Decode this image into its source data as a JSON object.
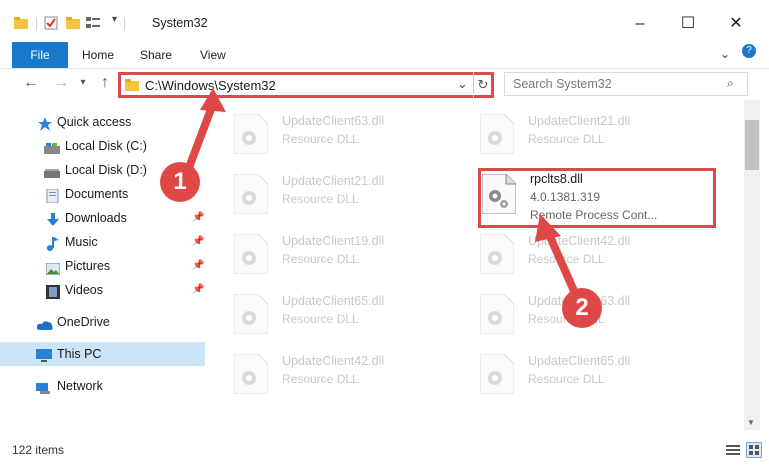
{
  "window": {
    "title": "System32",
    "controls": [
      "–",
      "☐",
      "✕"
    ]
  },
  "ribbon": {
    "file": "File",
    "tabs": [
      "Home",
      "Share",
      "View"
    ]
  },
  "address": {
    "path": "C:\\Windows\\System32"
  },
  "search": {
    "placeholder": "Search System32"
  },
  "sidebar": {
    "items": [
      {
        "label": "Quick access",
        "icon": "star-icon"
      },
      {
        "label": "Local Disk (C:)",
        "icon": "drive-icon"
      },
      {
        "label": "Local Disk (D:)",
        "icon": "drive-icon"
      },
      {
        "label": "Documents",
        "icon": "documents-icon"
      },
      {
        "label": "Downloads",
        "icon": "download-icon"
      },
      {
        "label": "Music",
        "icon": "music-icon"
      },
      {
        "label": "Pictures",
        "icon": "pictures-icon"
      },
      {
        "label": "Videos",
        "icon": "videos-icon"
      },
      {
        "label": "OneDrive",
        "icon": "cloud-icon"
      },
      {
        "label": "This PC",
        "icon": "computer-icon"
      },
      {
        "label": "Network",
        "icon": "network-icon"
      }
    ]
  },
  "files": {
    "left": [
      {
        "name": "UpdateClient63.dll",
        "desc": "Resource DLL"
      },
      {
        "name": "UpdateClient21.dll",
        "desc": "Resource DLL"
      },
      {
        "name": "UpdateClient19.dll",
        "desc": "Resource DLL"
      },
      {
        "name": "UpdateClient65.dll",
        "desc": "Resource DLL"
      },
      {
        "name": "UpdateClient42.dll",
        "desc": "Resource DLL"
      }
    ],
    "right": [
      {
        "name": "UpdateClient21.dll",
        "desc": "Resource DLL"
      },
      {
        "name": "UpdateClient42.dll",
        "desc": "Resource DLL"
      },
      {
        "name": "UpdateClient63.dll",
        "desc": "Resource DLL"
      },
      {
        "name": "UpdateClient65.dll",
        "desc": "Resource DLL"
      }
    ],
    "highlighted": {
      "name": "rpclts8.dll",
      "version": "4.0.1381.319",
      "desc": "Remote Process Cont..."
    }
  },
  "badges": [
    "1",
    "2"
  ],
  "status": {
    "count": "122 items"
  },
  "colors": {
    "accent": "#1979ca",
    "annotation": "#d94a4a",
    "selected": "#cce4f7"
  }
}
